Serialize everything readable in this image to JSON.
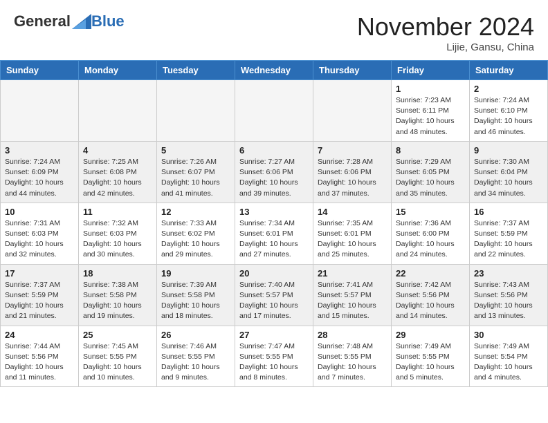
{
  "header": {
    "logo_general": "General",
    "logo_blue": "Blue",
    "month_title": "November 2024",
    "location": "Lijie, Gansu, China"
  },
  "days_of_week": [
    "Sunday",
    "Monday",
    "Tuesday",
    "Wednesday",
    "Thursday",
    "Friday",
    "Saturday"
  ],
  "weeks": [
    [
      {
        "day": null,
        "info": null
      },
      {
        "day": null,
        "info": null
      },
      {
        "day": null,
        "info": null
      },
      {
        "day": null,
        "info": null
      },
      {
        "day": null,
        "info": null
      },
      {
        "day": "1",
        "info": "Sunrise: 7:23 AM\nSunset: 6:11 PM\nDaylight: 10 hours and 48 minutes."
      },
      {
        "day": "2",
        "info": "Sunrise: 7:24 AM\nSunset: 6:10 PM\nDaylight: 10 hours and 46 minutes."
      }
    ],
    [
      {
        "day": "3",
        "info": "Sunrise: 7:24 AM\nSunset: 6:09 PM\nDaylight: 10 hours and 44 minutes."
      },
      {
        "day": "4",
        "info": "Sunrise: 7:25 AM\nSunset: 6:08 PM\nDaylight: 10 hours and 42 minutes."
      },
      {
        "day": "5",
        "info": "Sunrise: 7:26 AM\nSunset: 6:07 PM\nDaylight: 10 hours and 41 minutes."
      },
      {
        "day": "6",
        "info": "Sunrise: 7:27 AM\nSunset: 6:06 PM\nDaylight: 10 hours and 39 minutes."
      },
      {
        "day": "7",
        "info": "Sunrise: 7:28 AM\nSunset: 6:06 PM\nDaylight: 10 hours and 37 minutes."
      },
      {
        "day": "8",
        "info": "Sunrise: 7:29 AM\nSunset: 6:05 PM\nDaylight: 10 hours and 35 minutes."
      },
      {
        "day": "9",
        "info": "Sunrise: 7:30 AM\nSunset: 6:04 PM\nDaylight: 10 hours and 34 minutes."
      }
    ],
    [
      {
        "day": "10",
        "info": "Sunrise: 7:31 AM\nSunset: 6:03 PM\nDaylight: 10 hours and 32 minutes."
      },
      {
        "day": "11",
        "info": "Sunrise: 7:32 AM\nSunset: 6:03 PM\nDaylight: 10 hours and 30 minutes."
      },
      {
        "day": "12",
        "info": "Sunrise: 7:33 AM\nSunset: 6:02 PM\nDaylight: 10 hours and 29 minutes."
      },
      {
        "day": "13",
        "info": "Sunrise: 7:34 AM\nSunset: 6:01 PM\nDaylight: 10 hours and 27 minutes."
      },
      {
        "day": "14",
        "info": "Sunrise: 7:35 AM\nSunset: 6:01 PM\nDaylight: 10 hours and 25 minutes."
      },
      {
        "day": "15",
        "info": "Sunrise: 7:36 AM\nSunset: 6:00 PM\nDaylight: 10 hours and 24 minutes."
      },
      {
        "day": "16",
        "info": "Sunrise: 7:37 AM\nSunset: 5:59 PM\nDaylight: 10 hours and 22 minutes."
      }
    ],
    [
      {
        "day": "17",
        "info": "Sunrise: 7:37 AM\nSunset: 5:59 PM\nDaylight: 10 hours and 21 minutes."
      },
      {
        "day": "18",
        "info": "Sunrise: 7:38 AM\nSunset: 5:58 PM\nDaylight: 10 hours and 19 minutes."
      },
      {
        "day": "19",
        "info": "Sunrise: 7:39 AM\nSunset: 5:58 PM\nDaylight: 10 hours and 18 minutes."
      },
      {
        "day": "20",
        "info": "Sunrise: 7:40 AM\nSunset: 5:57 PM\nDaylight: 10 hours and 17 minutes."
      },
      {
        "day": "21",
        "info": "Sunrise: 7:41 AM\nSunset: 5:57 PM\nDaylight: 10 hours and 15 minutes."
      },
      {
        "day": "22",
        "info": "Sunrise: 7:42 AM\nSunset: 5:56 PM\nDaylight: 10 hours and 14 minutes."
      },
      {
        "day": "23",
        "info": "Sunrise: 7:43 AM\nSunset: 5:56 PM\nDaylight: 10 hours and 13 minutes."
      }
    ],
    [
      {
        "day": "24",
        "info": "Sunrise: 7:44 AM\nSunset: 5:56 PM\nDaylight: 10 hours and 11 minutes."
      },
      {
        "day": "25",
        "info": "Sunrise: 7:45 AM\nSunset: 5:55 PM\nDaylight: 10 hours and 10 minutes."
      },
      {
        "day": "26",
        "info": "Sunrise: 7:46 AM\nSunset: 5:55 PM\nDaylight: 10 hours and 9 minutes."
      },
      {
        "day": "27",
        "info": "Sunrise: 7:47 AM\nSunset: 5:55 PM\nDaylight: 10 hours and 8 minutes."
      },
      {
        "day": "28",
        "info": "Sunrise: 7:48 AM\nSunset: 5:55 PM\nDaylight: 10 hours and 7 minutes."
      },
      {
        "day": "29",
        "info": "Sunrise: 7:49 AM\nSunset: 5:55 PM\nDaylight: 10 hours and 5 minutes."
      },
      {
        "day": "30",
        "info": "Sunrise: 7:49 AM\nSunset: 5:54 PM\nDaylight: 10 hours and 4 minutes."
      }
    ]
  ]
}
